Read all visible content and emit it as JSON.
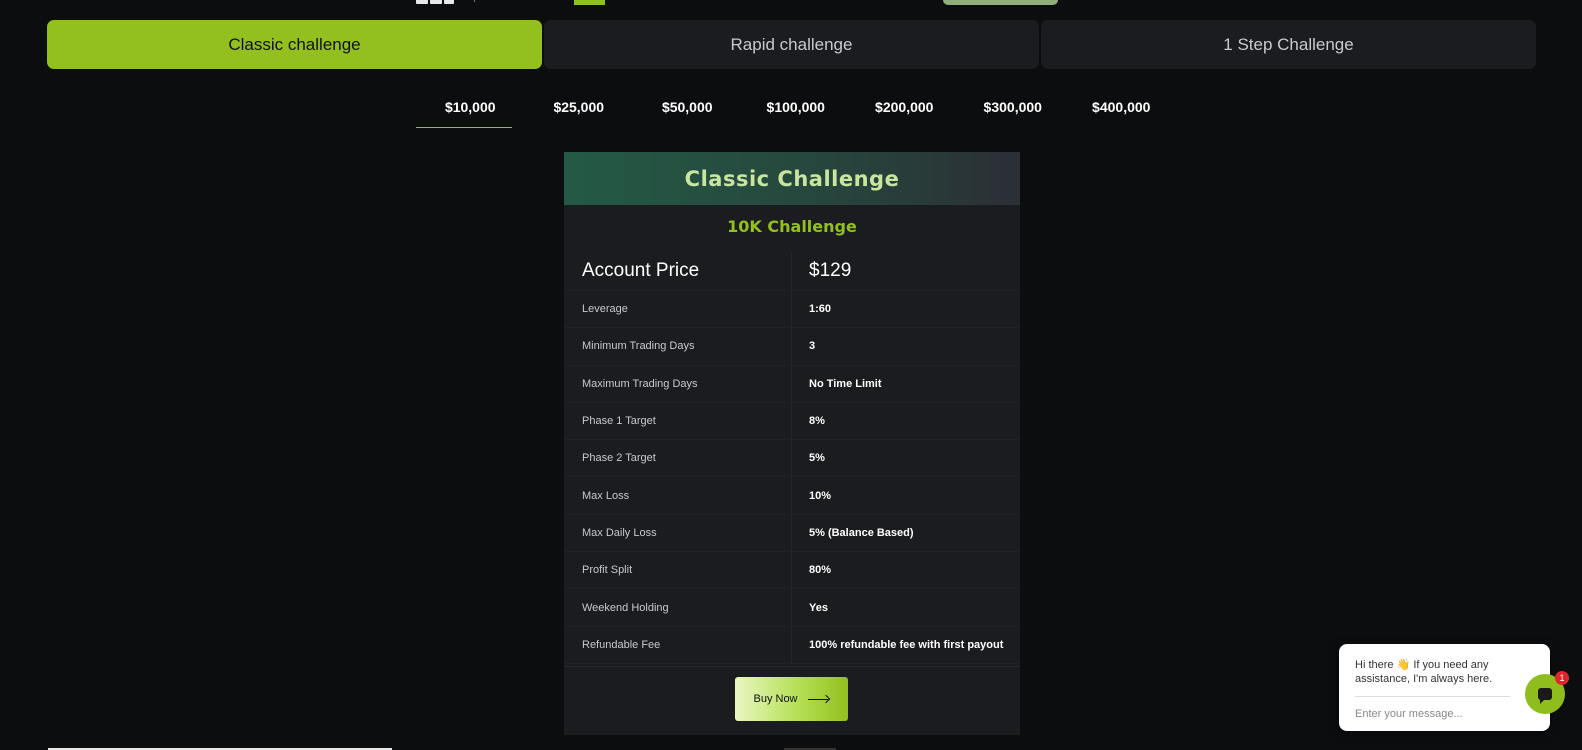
{
  "challenge_types": [
    {
      "label": "Classic challenge",
      "active": true
    },
    {
      "label": "Rapid challenge",
      "active": false
    },
    {
      "label": "1 Step Challenge",
      "active": false
    }
  ],
  "amounts": [
    {
      "label": "$10,000",
      "active": true
    },
    {
      "label": "$25,000",
      "active": false
    },
    {
      "label": "$50,000",
      "active": false
    },
    {
      "label": "$100,000",
      "active": false
    },
    {
      "label": "$200,000",
      "active": false
    },
    {
      "label": "$300,000",
      "active": false
    },
    {
      "label": "$400,000",
      "active": false
    }
  ],
  "card": {
    "title": "Classic Challenge",
    "subtitle": "10K Challenge",
    "price_label": "Account Price",
    "price_value": "$129",
    "rows": [
      {
        "label": "Leverage",
        "value": "1:60"
      },
      {
        "label": "Minimum Trading Days",
        "value": "3"
      },
      {
        "label": "Maximum Trading Days",
        "value": "No Time Limit"
      },
      {
        "label": "Phase 1 Target",
        "value": "8%"
      },
      {
        "label": "Phase 2 Target",
        "value": "5%"
      },
      {
        "label": "Max Loss",
        "value": "10%"
      },
      {
        "label": "Max Daily Loss",
        "value": "5% (Balance Based)"
      },
      {
        "label": "Profit Split",
        "value": "80%"
      },
      {
        "label": "Weekend Holding",
        "value": "Yes"
      },
      {
        "label": "Refundable Fee",
        "value": "100% refundable fee with first payout"
      }
    ],
    "buy_label": "Buy Now"
  },
  "chat": {
    "message": "Hi there 👋 If you need any assistance, I'm always here.",
    "placeholder": "Enter your message...",
    "badge_count": "1"
  },
  "colors": {
    "accent": "#93c01f",
    "background": "#0c0d0f",
    "card": "#1b1c1f"
  }
}
